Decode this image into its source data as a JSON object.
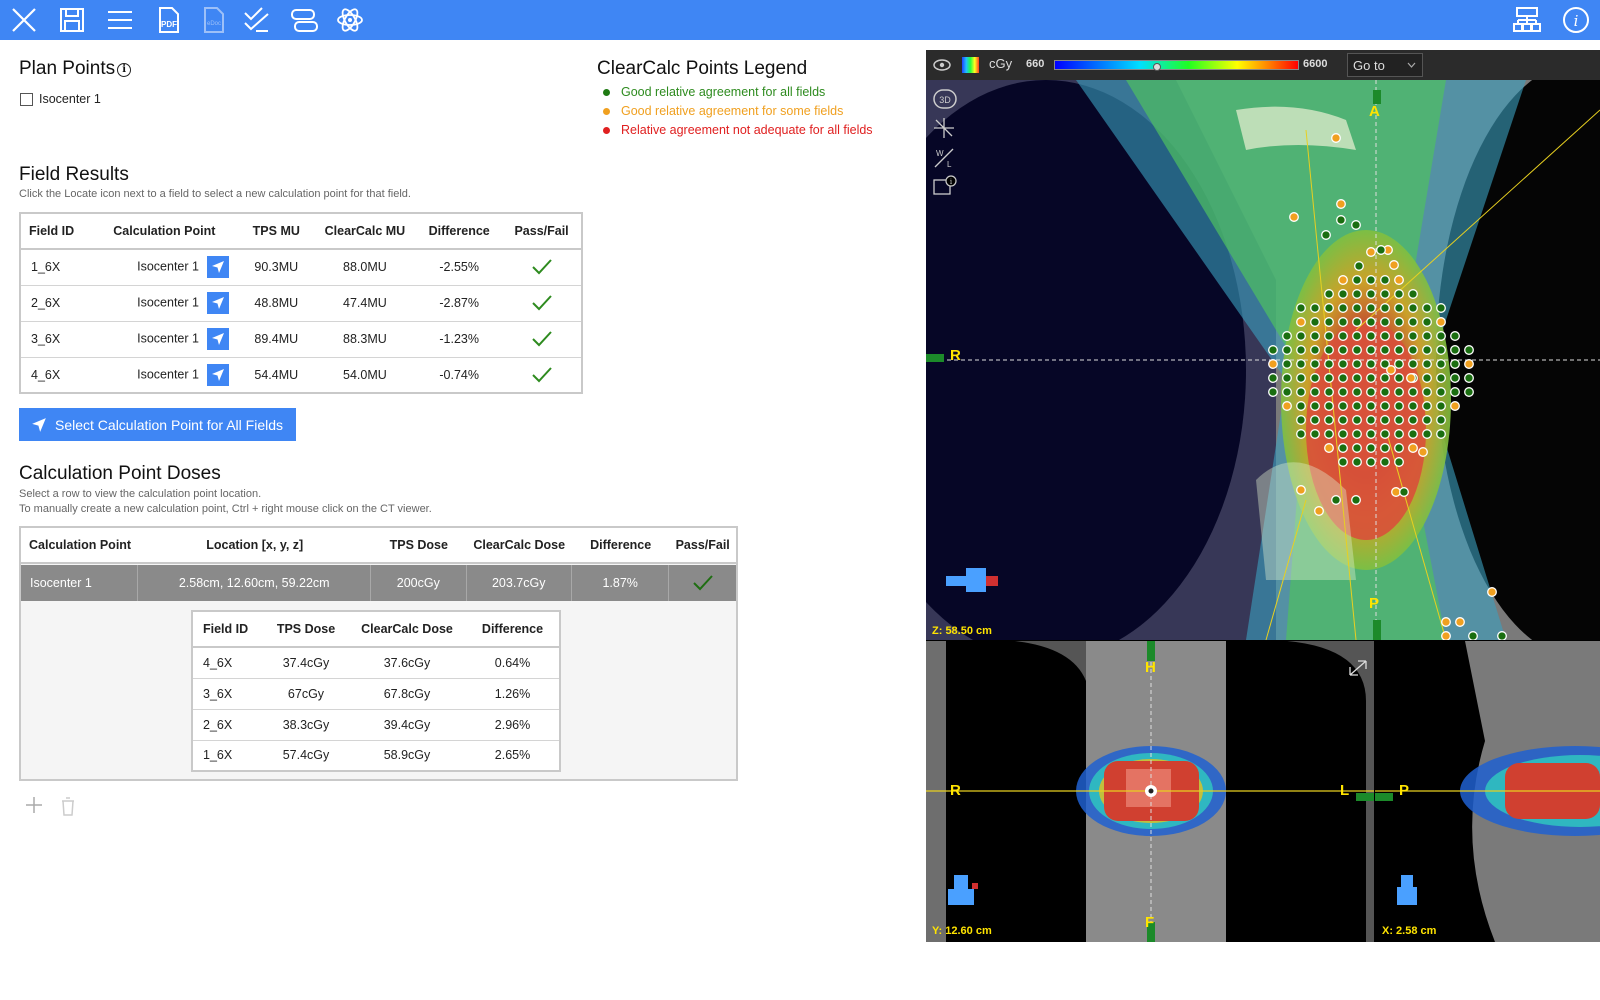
{
  "toolbar": {
    "items": [
      "close-icon",
      "save-icon",
      "menu-icon",
      "pdf-icon",
      "edoc-icon",
      "checklist-icon",
      "transfer-icon",
      "atom-icon",
      "network-icon",
      "info-icon"
    ],
    "pdf_label": "PDF",
    "edoc_label": "eDoc",
    "info_label": "i"
  },
  "plan_points": {
    "title": "Plan Points",
    "info": "i",
    "isocenter_label": "Isocenter 1",
    "checked": false
  },
  "legend": {
    "title": "ClearCalc Points Legend",
    "items": [
      {
        "label": "Good relative agreement for all fields",
        "color": "#2e8b1f"
      },
      {
        "label": "Good relative agreement for some fields",
        "color": "#f0a020"
      },
      {
        "label": "Relative agreement not adequate for all fields",
        "color": "#e02020"
      }
    ]
  },
  "field_results": {
    "title": "Field Results",
    "subtitle": "Click the Locate icon next to a field to select a new calculation point for that field.",
    "headers": [
      "Field ID",
      "Calculation Point",
      "TPS MU",
      "ClearCalc MU",
      "Difference",
      "Pass/Fail"
    ],
    "rows": [
      {
        "field": "1_6X",
        "point": "Isocenter 1",
        "tps": "90.3MU",
        "cc": "88.0MU",
        "diff": "-2.55%",
        "pass": true
      },
      {
        "field": "2_6X",
        "point": "Isocenter 1",
        "tps": "48.8MU",
        "cc": "47.4MU",
        "diff": "-2.87%",
        "pass": true
      },
      {
        "field": "3_6X",
        "point": "Isocenter 1",
        "tps": "89.4MU",
        "cc": "88.3MU",
        "diff": "-1.23%",
        "pass": true
      },
      {
        "field": "4_6X",
        "point": "Isocenter 1",
        "tps": "54.4MU",
        "cc": "54.0MU",
        "diff": "-0.74%",
        "pass": true
      }
    ],
    "select_all_label": "Select Calculation Point for All Fields"
  },
  "calc_point_doses": {
    "title": "Calculation Point Doses",
    "subtitle1": "Select a row to view the calculation point location.",
    "subtitle2": "To manually create a new calculation point, Ctrl + right mouse click on the CT viewer.",
    "headers": [
      "Calculation Point",
      "Location [x, y, z]",
      "TPS Dose",
      "ClearCalc Dose",
      "Difference",
      "Pass/Fail"
    ],
    "selected_row": {
      "point": "Isocenter 1",
      "location": "2.58cm, 12.60cm, 59.22cm",
      "tps": "200cGy",
      "cc": "203.7cGy",
      "diff": "1.87%",
      "pass": true
    },
    "sub_headers": [
      "Field ID",
      "TPS Dose",
      "ClearCalc Dose",
      "Difference"
    ],
    "sub_rows": [
      {
        "field": "4_6X",
        "tps": "37.4cGy",
        "cc": "37.6cGy",
        "diff": "0.64%"
      },
      {
        "field": "3_6X",
        "tps": "67cGy",
        "cc": "67.8cGy",
        "diff": "1.26%"
      },
      {
        "field": "2_6X",
        "tps": "38.3cGy",
        "cc": "39.4cGy",
        "diff": "2.96%"
      },
      {
        "field": "1_6X",
        "tps": "57.4cGy",
        "cc": "58.9cGy",
        "diff": "2.65%"
      }
    ]
  },
  "viewer": {
    "unit": "cGy",
    "min": "660",
    "max": "6600",
    "slider_fraction": 0.42,
    "goto_label": "Go to",
    "axial_z": "Z: 58.50 cm",
    "coronal_y": "Y: 12.60 cm",
    "sagittal_x": "X: 2.58 cm",
    "dir": {
      "A": "A",
      "P": "P",
      "R": "R",
      "L": "L",
      "H": "H",
      "F": "F"
    }
  }
}
